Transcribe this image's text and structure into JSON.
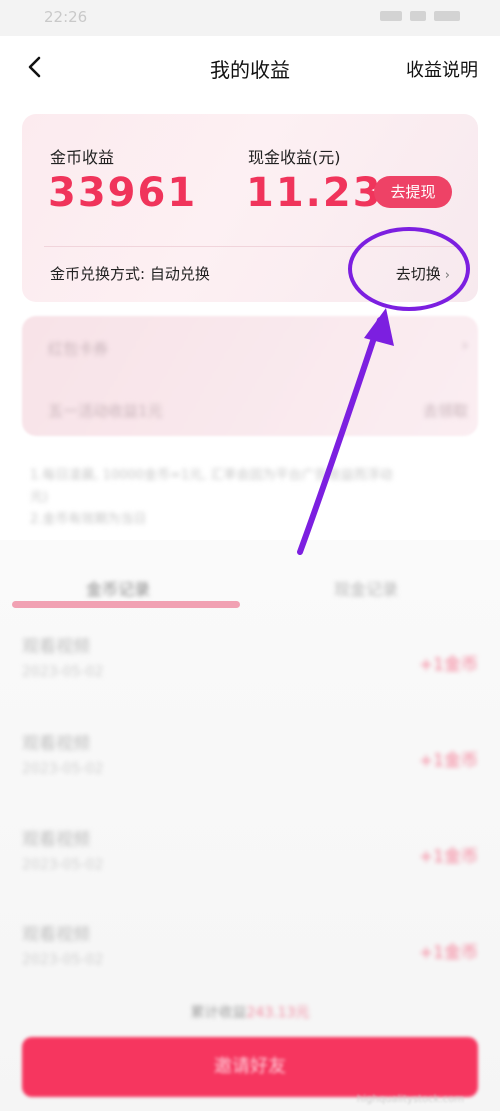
{
  "status_bar": {
    "time": "22:26"
  },
  "nav": {
    "title": "我的收益",
    "right_link": "收益说明"
  },
  "earnings": {
    "coin_label": "金币收益",
    "coin_value": "33961",
    "cash_label": "现金收益(元)",
    "cash_value": "11.23",
    "withdraw_button": "去提现",
    "exchange_mode": "金币兑换方式: 自动兑换",
    "switch_link": "去切换"
  },
  "blurred_card": {
    "row1_label": "红包卡券",
    "row2_label": "五一活动收益1元",
    "row2_action": "去领取"
  },
  "notes": [
    "1.每日凌晨, 10000金币=1元, 汇率会因为平台广告收益而浮动",
    "元)",
    "2.金币有效期为当日"
  ],
  "tabs": [
    "金币记录",
    "现金记录"
  ],
  "records": [
    {
      "title": "观看视频",
      "date": "2023-05-02",
      "value": "+1金币"
    },
    {
      "title": "观看视频",
      "date": "2023-05-02",
      "value": "+1金币"
    },
    {
      "title": "观看视频",
      "date": "2023-05-02",
      "value": "+1金币"
    },
    {
      "title": "观看视频",
      "date": "2023-05-02",
      "value": "+1金币"
    }
  ],
  "summary": {
    "prefix": "累计收益",
    "amount": "243.13元"
  },
  "bottom_button": "邀请好友",
  "watermark": "highqualitystock.com",
  "colors": {
    "accent": "#f0345b",
    "annotation": "#7c1fe0"
  }
}
